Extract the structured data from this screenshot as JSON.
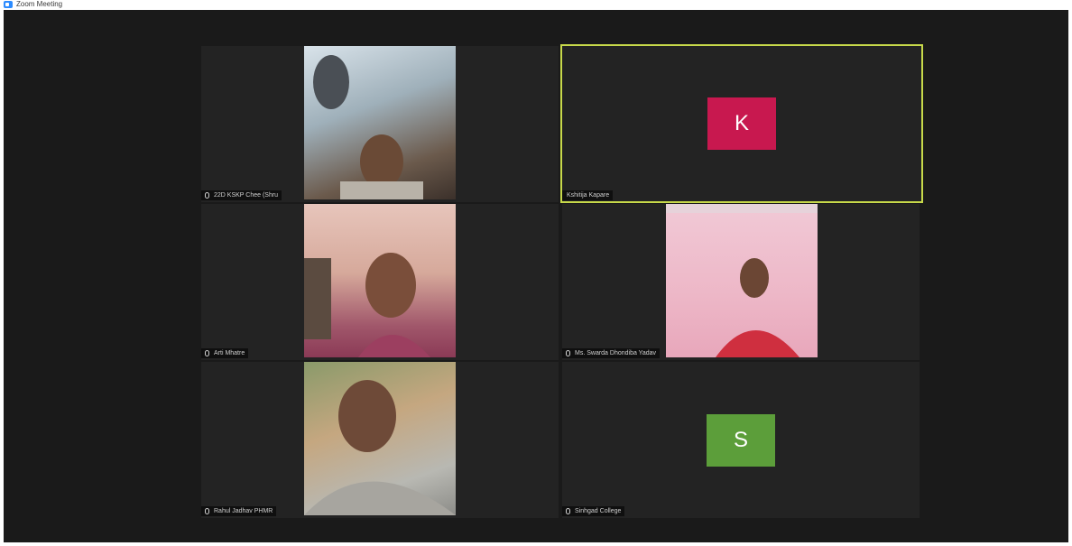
{
  "window": {
    "title": "Zoom Meeting",
    "icon": "zoom-app-icon"
  },
  "participants": [
    {
      "name": "22D KSKP Chee (Shru",
      "type": "video",
      "muted": true
    },
    {
      "name": "Kshitija Kapare",
      "type": "avatar",
      "initial": "K",
      "avatar_color": "#c8184f",
      "active_speaker": true,
      "muted": false
    },
    {
      "name": "Arti Mhatre",
      "type": "video",
      "muted": true
    },
    {
      "name": "Ms. Swarda Dhondiba Yadav",
      "type": "video",
      "muted": true
    },
    {
      "name": "Rahul Jadhav PHMR",
      "type": "video",
      "muted": true
    },
    {
      "name": "Sinhgad College",
      "type": "avatar",
      "initial": "S",
      "avatar_color": "#5c9e3a",
      "muted": true
    }
  ]
}
